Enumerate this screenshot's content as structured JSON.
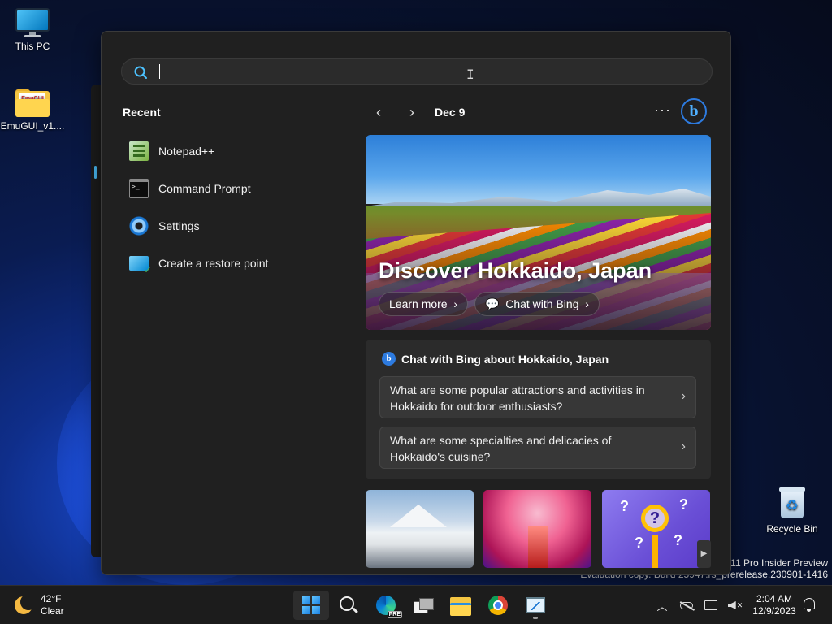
{
  "desktop": {
    "icons": [
      {
        "label": "This PC",
        "icon": "this-pc-icon"
      },
      {
        "label": "EmuGUI_v1....",
        "icon": "folder-icon",
        "folder_badge": "EmuGUI"
      },
      {
        "label": "Recycle Bin",
        "icon": "recycle-bin-icon"
      }
    ],
    "watermark": {
      "line1": "s 11 Pro Insider Preview",
      "line2": "Evaluation copy. Build 25947.rs_prerelease.230901-1416"
    }
  },
  "start": {
    "search": {
      "value": "",
      "placeholder": ""
    },
    "recent": {
      "title": "Recent",
      "items": [
        {
          "label": "Notepad++",
          "icon": "notepadpp-icon"
        },
        {
          "label": "Command Prompt",
          "icon": "command-prompt-icon"
        },
        {
          "label": "Settings",
          "icon": "settings-gear-icon"
        },
        {
          "label": "Create a restore point",
          "icon": "restore-point-icon"
        }
      ]
    },
    "feed": {
      "date": "Dec 9",
      "prev_glyph": "‹",
      "next_glyph": "›",
      "more_glyph": "···",
      "bing_glyph": "b",
      "hero": {
        "title": "Discover Hokkaido, Japan",
        "learn_more": "Learn more",
        "chat_with_bing": "Chat with Bing"
      },
      "chat": {
        "heading": "Chat with Bing about Hokkaido, Japan",
        "questions": [
          "What are some popular attractions and activities in Hokkaido for outdoor enthusiasts?",
          "What are some specialties and delicacies of Hokkaido's cuisine?"
        ]
      }
    }
  },
  "taskbar": {
    "weather": {
      "temp": "42°F",
      "condition": "Clear"
    },
    "clock": {
      "time": "2:04 AM",
      "date": "12/9/2023"
    }
  },
  "colors": {
    "accent": "#4cc2ff",
    "panel": "#202020",
    "bing": "#2d7be0"
  }
}
